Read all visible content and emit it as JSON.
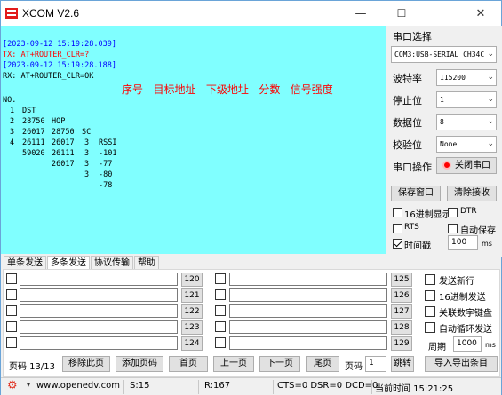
{
  "window": {
    "title": "XCOM V2.6",
    "min": "—",
    "max": "☐",
    "close": "✕"
  },
  "receive": {
    "lines": [
      {
        "text": "[2023-09-12 15:19:28.039]",
        "color": "blue"
      },
      {
        "text": "TX: AT+ROUTER_CLR=?",
        "color": "red"
      },
      {
        "text": "[2023-09-12 15:19:28.188]",
        "color": "blue"
      },
      {
        "text": "RX: AT+ROUTER_CLR=OK",
        "color": "dark"
      }
    ],
    "table_headers": [
      "NO.",
      "DST",
      "HOP",
      "SC",
      "RSSI"
    ],
    "table_rows": [
      [
        "1",
        "28750",
        "28750",
        "3",
        "-101"
      ],
      [
        "2",
        "26017",
        "26017",
        "3",
        "-77"
      ],
      [
        "3",
        "26111",
        "26111",
        "3",
        "-80"
      ],
      [
        "4",
        "59020",
        "26017",
        "3",
        "-78"
      ]
    ],
    "annotation": "序号   目标地址   下级地址   分数   信号强度"
  },
  "serial_panel": {
    "section_title": "串口选择",
    "port": "COM3:USB-SERIAL CH34C",
    "baud_label": "波特率",
    "baud": "115200",
    "stop_label": "停止位",
    "stop": "1",
    "data_label": "数据位",
    "data": "8",
    "parity_label": "校验位",
    "parity": "None",
    "op_label": "串口操作",
    "op_button": "关闭串口",
    "save_window": "保存窗口",
    "clear_receive": "清除接收",
    "hex_display": "16进制显示",
    "dtr": "DTR",
    "rts": "RTS",
    "auto_save": "自动保存",
    "timestamp": "时间戳",
    "timestamp_value": "100",
    "ms": "ms"
  },
  "tabs": [
    "单条发送",
    "多条发送",
    "协议传输",
    "帮助"
  ],
  "multi_send": {
    "left_buttons": [
      "120",
      "121",
      "122",
      "123",
      "124"
    ],
    "right_buttons": [
      "125",
      "126",
      "127",
      "128",
      "129"
    ],
    "options": [
      "发送新行",
      "16进制发送",
      "关联数字键盘",
      "自动循环发送"
    ],
    "period_label": "周期",
    "period_value": "1000",
    "ms": "ms",
    "page_label": "页码 13/13",
    "move_page": "移除此页",
    "add_page": "添加页码",
    "first_page": "首页",
    "prev_page": "上一页",
    "next_page": "下一页",
    "last_page": "尾页",
    "page_input_label": "页码",
    "page_input_value": "1",
    "jump": "跳转",
    "import_export": "导入导出条目"
  },
  "statusbar": {
    "url": "www.openedv.com",
    "s": "S:15",
    "r": "R:167",
    "signals": "CTS=0 DSR=0 DCD=0",
    "time": "当前时间 15:21:25"
  }
}
